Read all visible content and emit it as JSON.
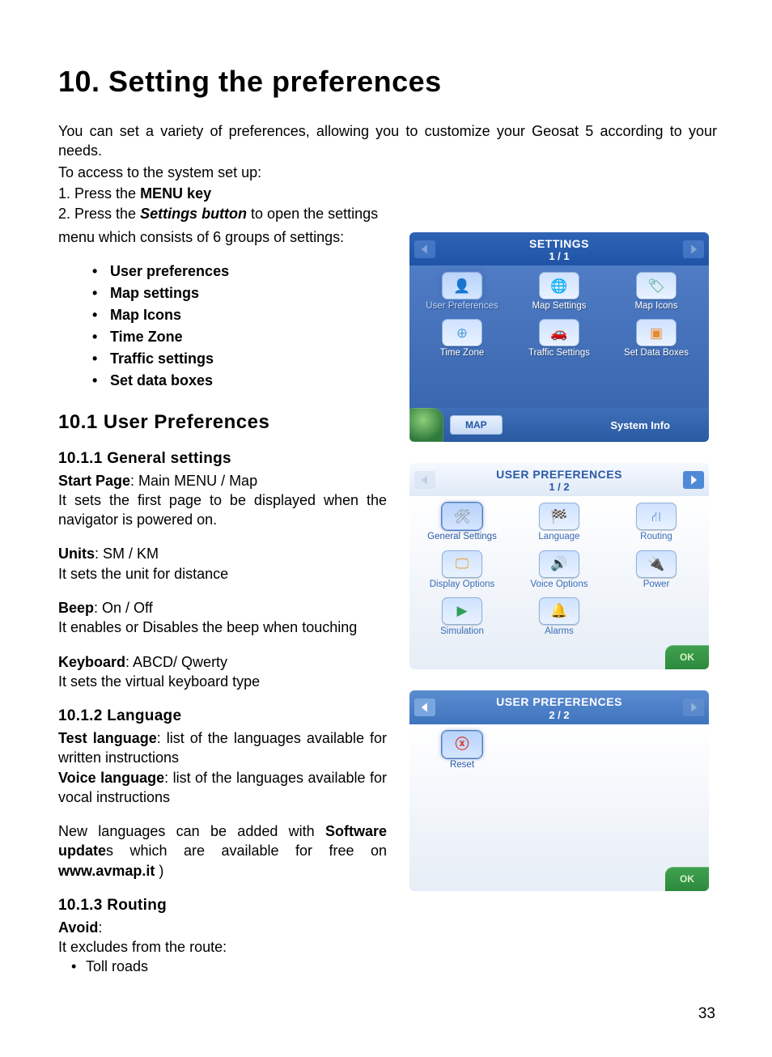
{
  "pageNumber": "33",
  "heading": "10. Setting the preferences",
  "intro": "You can set a variety of preferences, allowing you to customize your Geosat 5 according to your needs.",
  "accessLine": "To access to the system set up:",
  "steps": {
    "s1_prefix": "1.  Press the ",
    "s1_bold": "MENU key",
    "s2_prefix": "2.  Press the ",
    "s2_bi": "Settings button",
    "s2_suffix_a": " to open the settings",
    "s2_line2": "menu which consists of 6 groups of settings:"
  },
  "bullets": [
    "User preferences",
    "Map settings",
    "Map Icons",
    "Time Zone",
    "Traffic settings",
    "Set data boxes"
  ],
  "h2_10_1": "10.1  User Preferences",
  "h3_10_1_1": "10.1.1  General settings",
  "gs": {
    "sp_b": "Start Page",
    "sp_v": ": Main MENU / Map",
    "sp_desc": "It sets the first page to be displayed when the navigator is powered on.",
    "un_b": "Units",
    "un_v": ": SM / KM",
    "un_desc": "It sets the unit for distance",
    "bp_b": "Beep",
    "bp_v": ": On / Off",
    "bp_desc": "It enables or Disables the beep when touching",
    "kb_b": "Keyboard",
    "kb_v": ": ABCD/ Qwerty",
    "kb_desc": "It sets the virtual keyboard type"
  },
  "h3_10_1_2": "10.1.2  Language",
  "lang": {
    "tl_b": "Test language",
    "tl_v": ": list of the languages available for written instructions",
    "vl_b": "Voice language",
    "vl_v": ": list of the languages available for vocal instructions",
    "nl_pre": "New languages can be added with ",
    "nl_b1": "Software update",
    "nl_mid": "s which are available for free on ",
    "nl_b2": "www.avmap.it",
    "nl_suf": "  )"
  },
  "h3_10_1_3": "10.1.3  Routing",
  "routing": {
    "avoid_b": "Avoid",
    "avoid_c": ":",
    "desc": "It excludes from the route:",
    "item1": "Toll roads"
  },
  "screens": {
    "s1": {
      "title": "SETTINGS",
      "pager": "1 / 1",
      "tiles": [
        {
          "label": "User Preferences",
          "icon": "user"
        },
        {
          "label": "Map Settings",
          "icon": "globe"
        },
        {
          "label": "Map Icons",
          "icon": "tag"
        },
        {
          "label": "Time Zone",
          "icon": "clock"
        },
        {
          "label": "Traffic Settings",
          "icon": "car"
        },
        {
          "label": "Set Data Boxes",
          "icon": "box"
        }
      ],
      "footer_btn": "MAP",
      "footer_right": "System Info"
    },
    "s2": {
      "title": "USER PREFERENCES",
      "pager": "1 / 2",
      "tiles": [
        {
          "label": "General Settings",
          "icon": "tools"
        },
        {
          "label": "Language",
          "icon": "flag"
        },
        {
          "label": "Routing",
          "icon": "route"
        },
        {
          "label": "Display Options",
          "icon": "sun"
        },
        {
          "label": "Voice Options",
          "icon": "speaker"
        },
        {
          "label": "Power",
          "icon": "plug"
        },
        {
          "label": "Simulation",
          "icon": "play"
        },
        {
          "label": "Alarms",
          "icon": "bell"
        }
      ],
      "ok": "OK"
    },
    "s3": {
      "title": "USER PREFERENCES",
      "pager": "2 / 2",
      "tiles": [
        {
          "label": "Reset",
          "icon": "reset"
        }
      ],
      "ok": "OK"
    }
  }
}
